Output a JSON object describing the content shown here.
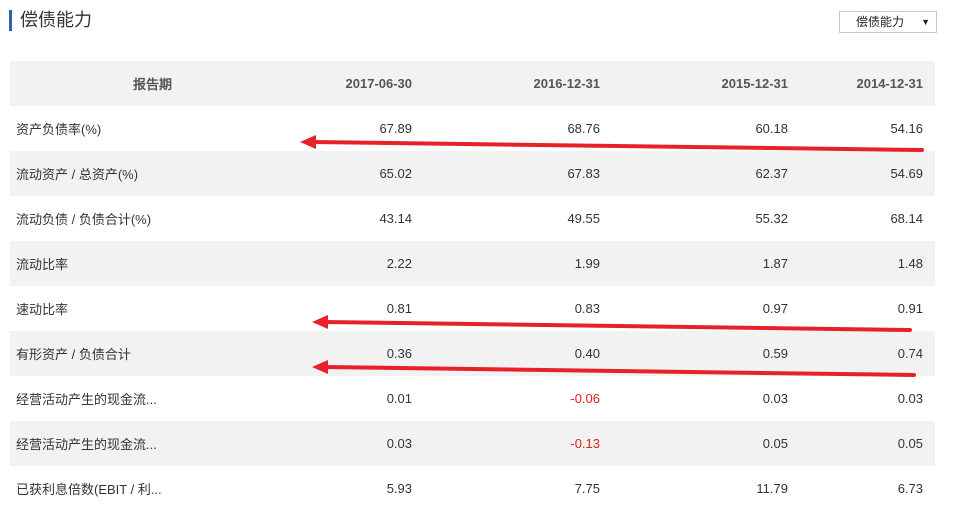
{
  "header": {
    "title": "偿债能力"
  },
  "selector": {
    "value": "偿债能力",
    "arrow": "▼"
  },
  "table": {
    "columns": [
      "报告期",
      "2017-06-30",
      "2016-12-31",
      "2015-12-31",
      "2014-12-31"
    ],
    "rows": [
      {
        "label": "资产负债率(%)",
        "values": [
          "67.89",
          "68.76",
          "60.18",
          "54.16"
        ]
      },
      {
        "label": "流动资产 / 总资产(%)",
        "values": [
          "65.02",
          "67.83",
          "62.37",
          "54.69"
        ]
      },
      {
        "label": "流动负债 / 负债合计(%)",
        "values": [
          "43.14",
          "49.55",
          "55.32",
          "68.14"
        ]
      },
      {
        "label": "流动比率",
        "values": [
          "2.22",
          "1.99",
          "1.87",
          "1.48"
        ]
      },
      {
        "label": "速动比率",
        "values": [
          "0.81",
          "0.83",
          "0.97",
          "0.91"
        ]
      },
      {
        "label": "有形资产 / 负债合计",
        "values": [
          "0.36",
          "0.40",
          "0.59",
          "0.74"
        ]
      },
      {
        "label": "经营活动产生的现金流...",
        "values": [
          "0.01",
          "-0.06",
          "0.03",
          "0.03"
        ]
      },
      {
        "label": "经营活动产生的现金流...",
        "values": [
          "0.03",
          "-0.13",
          "0.05",
          "0.05"
        ]
      },
      {
        "label": "已获利息倍数(EBIT / 利...",
        "values": [
          "5.93",
          "7.75",
          "11.79",
          "6.73"
        ]
      }
    ]
  },
  "annotations": {
    "arrow_color": "#e8202a",
    "arrow_rows": [
      0,
      4,
      5
    ]
  },
  "colors": {
    "accent": "#2f63a8",
    "negative": "#e02020",
    "stripe": "#f2f2f2"
  }
}
